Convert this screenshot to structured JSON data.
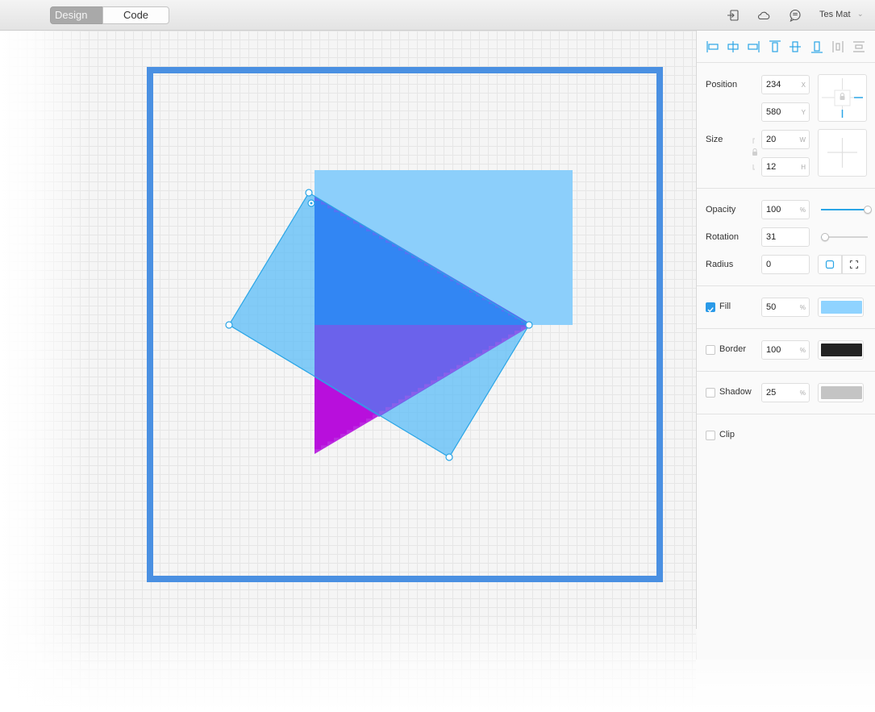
{
  "toolbar": {
    "tabs": [
      {
        "label": "Design",
        "active": true
      },
      {
        "label": "Code",
        "active": false
      }
    ],
    "icons": [
      "export-icon",
      "cloud-icon",
      "comment-icon"
    ],
    "user": "Tes Mat"
  },
  "inspector": {
    "align_icons": [
      "align-left-icon",
      "align-center-horizontal-icon",
      "align-right-icon",
      "align-top-icon",
      "align-middle-vertical-icon",
      "align-bottom-icon",
      "distribute-horizontal-icon",
      "distribute-vertical-icon"
    ],
    "position": {
      "label": "Position",
      "x": "234",
      "x_unit": "X",
      "y": "580",
      "y_unit": "Y"
    },
    "size": {
      "label": "Size",
      "w": "20",
      "w_unit": "W",
      "h": "12",
      "h_unit": "H"
    },
    "opacity": {
      "label": "Opacity",
      "value": "100",
      "unit": "%",
      "slider_fraction": 1.0
    },
    "rotation": {
      "label": "Rotation",
      "value": "31",
      "slider_fraction": 0.09
    },
    "radius": {
      "label": "Radius",
      "value": "0"
    },
    "fill": {
      "label": "Fill",
      "checked": true,
      "value": "50",
      "unit": "%",
      "color": "#8fd3ff"
    },
    "border": {
      "label": "Border",
      "checked": false,
      "value": "100",
      "unit": "%",
      "color": "#222222"
    },
    "shadow": {
      "label": "Shadow",
      "checked": false,
      "value": "25",
      "unit": "%",
      "color": "#c4c4c4"
    },
    "clip": {
      "label": "Clip",
      "checked": false
    }
  },
  "colors": {
    "accent": "#2a9ae8",
    "artboard_border": "#4a90e2",
    "rect_fill": "#8ccffb",
    "rotated_fill": "#72c4f6",
    "triangle_blue": "#2e86f2",
    "triangle_violet": "#6a60ea",
    "triangle_magenta": "#b80fdc"
  }
}
